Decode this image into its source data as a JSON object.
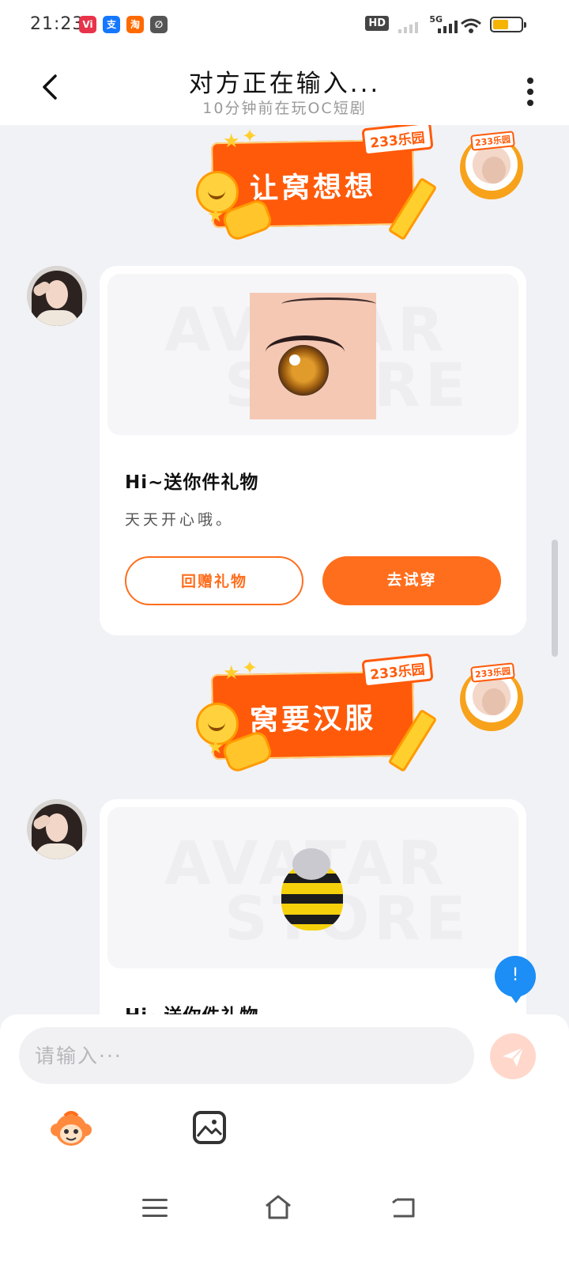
{
  "status_bar": {
    "time": "21:23",
    "apps": [
      {
        "label": "Vi",
        "color": "#e8334a"
      },
      {
        "label": "支",
        "color": "#1677ff"
      },
      {
        "label": "淘",
        "color": "#ff6a00"
      },
      {
        "label": "∅",
        "color": "#555555"
      }
    ],
    "hd_label": "HD",
    "network_label": "5G",
    "battery_level": 0.55
  },
  "header": {
    "title": "对方正在输入...",
    "subtitle": "10分钟前在玩OC短剧"
  },
  "messages": [
    {
      "type": "sticker",
      "side": "right",
      "text": "让窝想想",
      "brand": "233乐园"
    },
    {
      "type": "gift",
      "side": "left",
      "image": "anime-eye",
      "watermark": [
        "AVATAR",
        "STORE"
      ],
      "title": "Hi~送你件礼物",
      "desc": "天天开心哦。",
      "btn_return": "回赠礼物",
      "btn_try": "去试穿"
    },
    {
      "type": "sticker",
      "side": "right",
      "text": "窝要汉服",
      "brand": "233乐园"
    },
    {
      "type": "gift",
      "side": "left",
      "image": "bee-plush",
      "watermark": [
        "AVATAR",
        "STORE"
      ],
      "title": "Hi~送你件礼物"
    }
  ],
  "fab_label": "!",
  "composer": {
    "placeholder": "请输入···",
    "send_icon": "paper-plane-icon",
    "tools": [
      "monkey-emoji-icon",
      "image-icon"
    ]
  },
  "nav": [
    "menu-icon",
    "home-icon",
    "back-icon"
  ],
  "colors": {
    "accent": "#ff6e1d",
    "fab": "#1c8ef5",
    "background": "#f1f2f6"
  }
}
